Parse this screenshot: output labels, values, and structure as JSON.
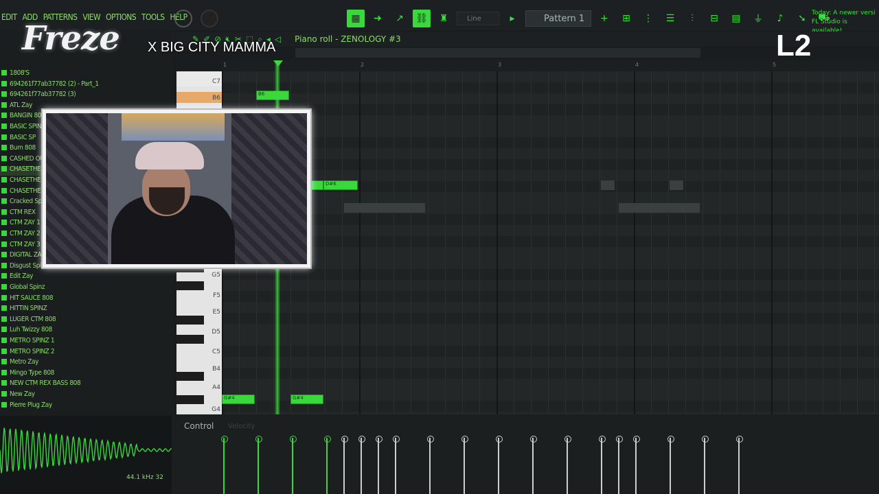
{
  "menubar": {
    "items": [
      "EDIT",
      "ADD",
      "PATTERNS",
      "VIEW",
      "OPTIONS",
      "TOOLS",
      "HELP"
    ],
    "snap_label": "Line",
    "pattern_label": "Pattern 1",
    "news_line1": "Today: A newer versi",
    "news_line2": "FL Studio is available!"
  },
  "piano_roll": {
    "title": "Piano roll - ZENOLOGY #3",
    "ruler": [
      "1",
      "2",
      "3",
      "4",
      "5"
    ],
    "keys": [
      "C7",
      "B6",
      "G5",
      "F5",
      "E5",
      "D5",
      "C5",
      "B4",
      "A4",
      "G4"
    ],
    "notes": [
      {
        "pitch": "B6",
        "label": "B6"
      },
      {
        "pitch": "D#6",
        "label": "D#6"
      },
      {
        "pitch": "G#4",
        "label": "G#4"
      },
      {
        "pitch": "G#4",
        "label": "G#4"
      }
    ]
  },
  "control": {
    "label": "Control",
    "parameter": "Velocity"
  },
  "browser": {
    "items": [
      "1808'S",
      "694261f77ab37782 (2) - Part_1",
      "694261f77ab37782 (3)",
      "ATL Zay",
      "BANGIN 808",
      "BASIC SPINZ",
      "BASIC SP",
      "Bum 808",
      "CASHED OU",
      "CHASETHE",
      "CHASETHE",
      "CHASETHE",
      "Cracked Sp",
      "CTM REX",
      "CTM ZAY 1",
      "CTM ZAY 2",
      "CTM ZAY 3",
      "DIGITAL ZA",
      "Disgust Spinz",
      "Edit Zay",
      "Global Spinz",
      "HIT SAUCE 808",
      "HITTIN SPINZ",
      "LUGER CTM 808",
      "Luh Twizzy 808",
      "METRO SPINZ 1",
      "METRO SPINZ 2",
      "Metro Zay",
      "Mingo Type 808",
      "NEW CTM REX BASS 808",
      "New Zay",
      "Pierre Plug Zay"
    ],
    "waveform_info": "44.1 kHz 32"
  },
  "overlay": {
    "logo": "Freze",
    "collab": "X BIG CITY MAMMA",
    "corner": "L2"
  },
  "colors": {
    "accent": "#3ad83d",
    "background": "#1a1d1f"
  }
}
